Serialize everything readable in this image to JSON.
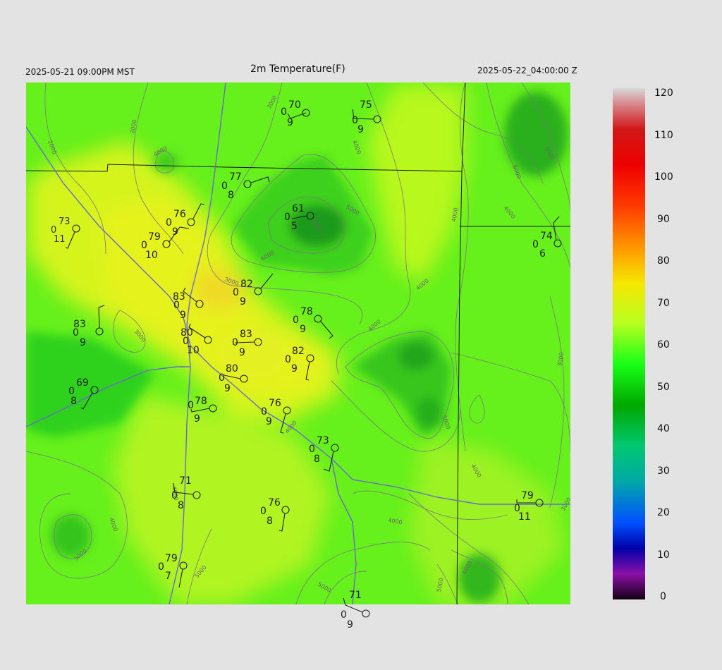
{
  "header": {
    "valid_local": "2025-05-21 09:00PM MST",
    "title": "2m Temperature(F)",
    "valid_utc": "2025-05-22_04:00:00 Z"
  },
  "colorbar": {
    "ticks": [
      "120",
      "110",
      "100",
      "90",
      "80",
      "70",
      "60",
      "50",
      "40",
      "30",
      "20",
      "10",
      "0"
    ]
  },
  "contour_labels": [
    "2000",
    "3000",
    "4000",
    "3000",
    "4000",
    "5000",
    "6000",
    "3000",
    "3000",
    "4000",
    "4000",
    "5000",
    "6000",
    "5000",
    "4000",
    "4000",
    "3000",
    "4000",
    "4000",
    "5000",
    "4000",
    "4000",
    "5000",
    "6000",
    "5000",
    "5000",
    "5000",
    "4000",
    "3000"
  ],
  "stations": [
    {
      "temp": "70",
      "mid": "0",
      "dew": "9"
    },
    {
      "temp": "75",
      "mid": "0",
      "dew": "9"
    },
    {
      "temp": "77",
      "mid": "0",
      "dew": "8"
    },
    {
      "temp": "61",
      "mid": "0",
      "dew": "5"
    },
    {
      "temp": "73",
      "mid": "0",
      "dew": "11"
    },
    {
      "temp": "76",
      "mid": "0",
      "dew": "9"
    },
    {
      "temp": "79",
      "mid": "0",
      "dew": "10"
    },
    {
      "temp": "74",
      "mid": "0",
      "dew": "6"
    },
    {
      "temp": "82",
      "mid": "0",
      "dew": "9"
    },
    {
      "temp": "83",
      "mid": "0",
      "dew": "9"
    },
    {
      "temp": "78",
      "mid": "0",
      "dew": "9"
    },
    {
      "temp": "83",
      "mid": "0",
      "dew": "9"
    },
    {
      "temp": "80",
      "mid": "0",
      "dew": "10"
    },
    {
      "temp": "83",
      "mid": "0",
      "dew": "9"
    },
    {
      "temp": "82",
      "mid": "0",
      "dew": "9"
    },
    {
      "temp": "80",
      "mid": "0",
      "dew": "9"
    },
    {
      "temp": "69",
      "mid": "0",
      "dew": "8"
    },
    {
      "temp": "78",
      "mid": "0",
      "dew": "9"
    },
    {
      "temp": "76",
      "mid": "0",
      "dew": "9"
    },
    {
      "temp": "73",
      "mid": "0",
      "dew": "8"
    },
    {
      "temp": "71",
      "mid": "0",
      "dew": "8"
    },
    {
      "temp": "76",
      "mid": "0",
      "dew": "8"
    },
    {
      "temp": "79",
      "mid": "0",
      "dew": "11"
    },
    {
      "temp": "79",
      "mid": "0",
      "dew": "7"
    },
    {
      "temp": "71",
      "mid": "0",
      "dew": "9"
    }
  ]
}
